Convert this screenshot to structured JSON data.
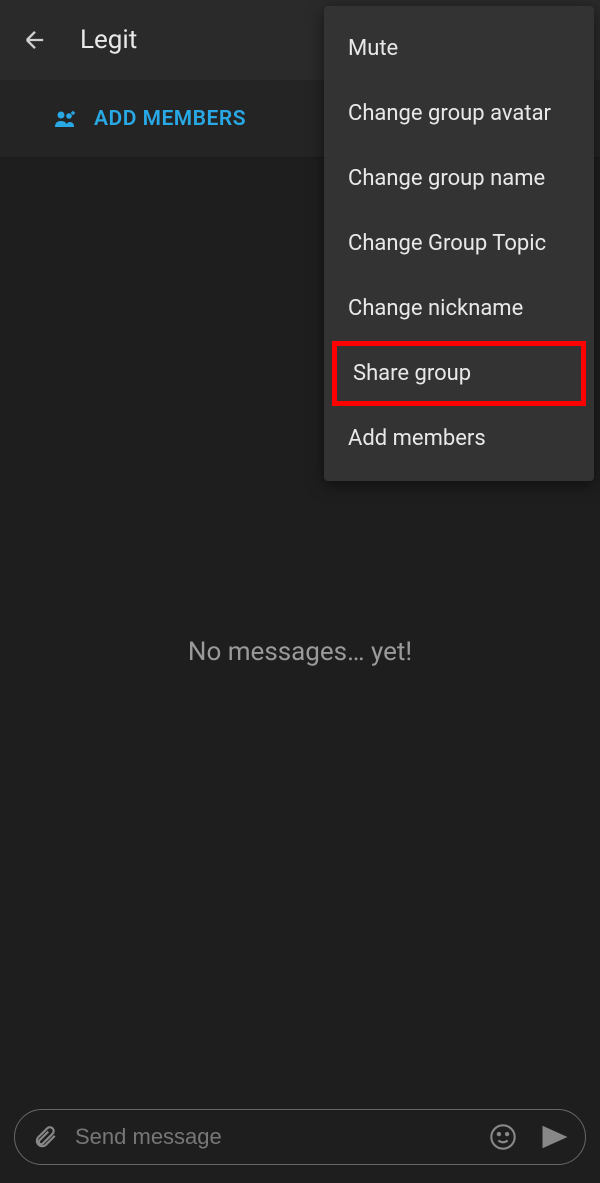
{
  "header": {
    "title": "Legit"
  },
  "addMembersBar": {
    "label": "ADD MEMBERS"
  },
  "menu": {
    "items": [
      {
        "label": "Mute",
        "highlighted": false
      },
      {
        "label": "Change group avatar",
        "highlighted": false
      },
      {
        "label": "Change group name",
        "highlighted": false
      },
      {
        "label": "Change Group Topic",
        "highlighted": false
      },
      {
        "label": "Change nickname",
        "highlighted": false
      },
      {
        "label": "Share group",
        "highlighted": true
      },
      {
        "label": "Add members",
        "highlighted": false
      }
    ]
  },
  "content": {
    "emptyMessage": "No messages… yet!"
  },
  "input": {
    "placeholder": "Send message"
  }
}
